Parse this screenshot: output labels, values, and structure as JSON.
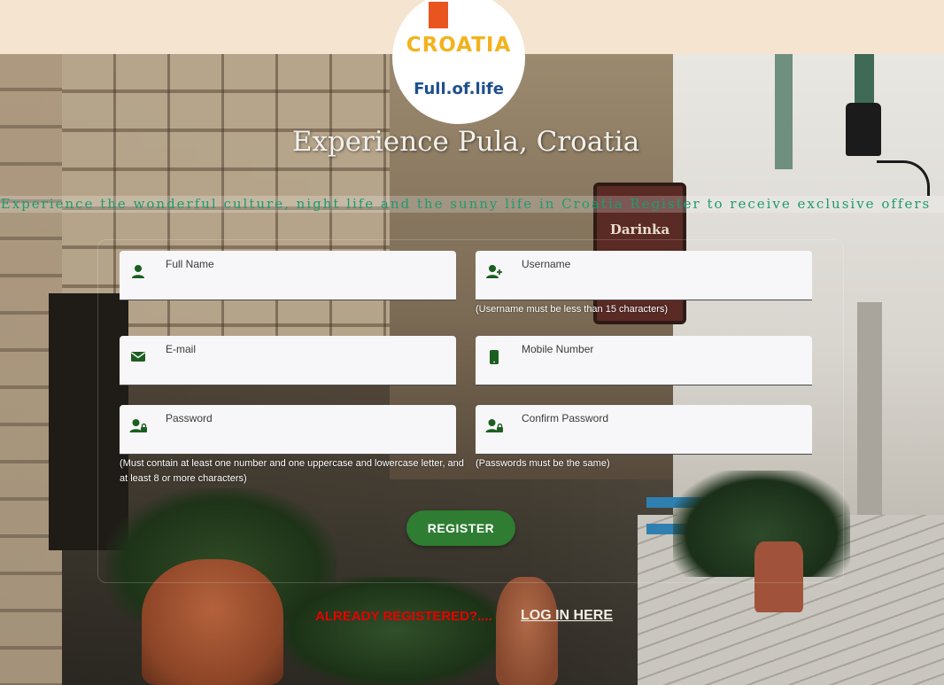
{
  "logo": {
    "brand": "CROATIA",
    "tagline": "Full.of.life"
  },
  "header": {
    "title": "Experience Pula, Croatia",
    "tagline": "Experience the wonderful culture, night life and the sunny life in Croatia Register to receive exclusive offers"
  },
  "form": {
    "full_name": {
      "label": "Full Name",
      "value": "",
      "icon": "person-icon"
    },
    "username": {
      "label": "Username",
      "value": "",
      "icon": "add-person-icon",
      "hint": "(Username must be less than 15 characters)"
    },
    "email": {
      "label": "E-mail",
      "value": "",
      "icon": "envelope-icon"
    },
    "mobile": {
      "label": "Mobile Number",
      "value": "",
      "icon": "mobile-phone-icon"
    },
    "password": {
      "label": "Password",
      "value": "",
      "icon": "person-lock-icon",
      "hint": "(Must contain at least one number and one uppercase and lowercase letter, and at least 8 or more characters)"
    },
    "confirm_password": {
      "label": "Confirm Password",
      "value": "",
      "icon": "person-lock-icon",
      "hint": "(Passwords must be the same)"
    },
    "submit_label": "REGISTER"
  },
  "footer": {
    "already_text": "ALREADY REGISTERED?....",
    "login_label": "LOG IN HERE"
  },
  "colors": {
    "topbar": "#f5e4cf",
    "icon_green": "#1b5e20",
    "button_green": "#2e7d32",
    "tagline_green": "#1e9c6e",
    "alert_red": "#e60000"
  }
}
